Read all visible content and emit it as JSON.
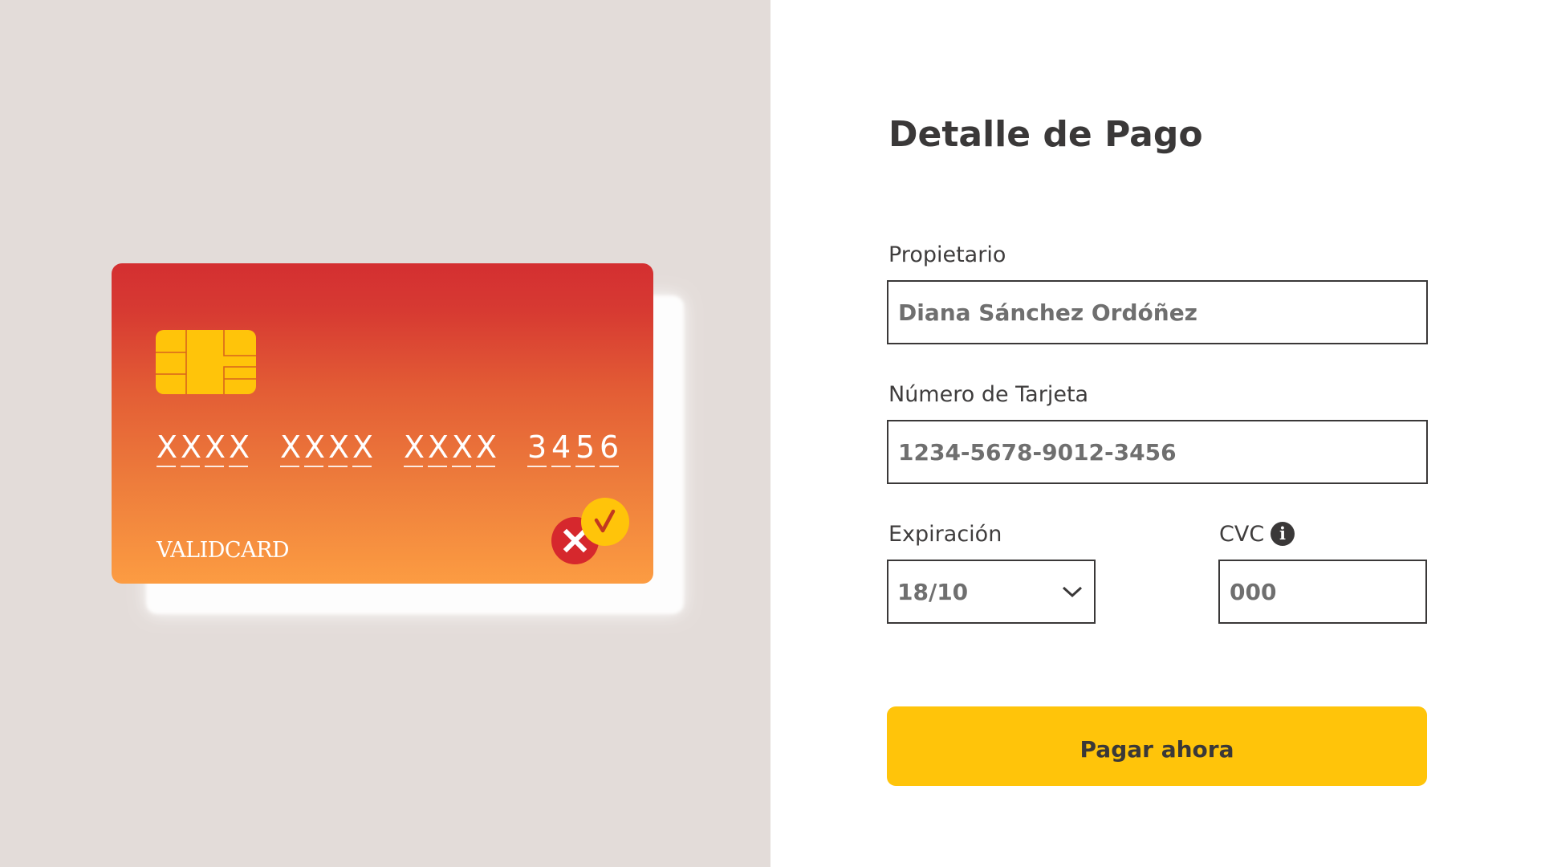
{
  "card": {
    "number_groups": [
      [
        "X",
        "X",
        "X",
        "X"
      ],
      [
        "X",
        "X",
        "X",
        "X"
      ],
      [
        "X",
        "X",
        "X",
        "X"
      ],
      [
        "3",
        "4",
        "5",
        "6"
      ]
    ],
    "brand": "VALIDCARD",
    "status_icons": [
      "close-icon",
      "check-icon"
    ]
  },
  "form": {
    "title": "Detalle de Pago",
    "owner": {
      "label": "Propietario",
      "value": "Diana Sánchez Ordóñez"
    },
    "card_number": {
      "label": "Número de Tarjeta",
      "value": "1234-5678-9012-3456"
    },
    "expiration": {
      "label": "Expiración",
      "value": "18/10"
    },
    "cvc": {
      "label": "CVC",
      "value": "000",
      "icon": "info-icon"
    },
    "submit_label": "Pagar ahora"
  },
  "colors": {
    "left_background": "#e3dcd9",
    "card_gradient_top": "#d42f31",
    "card_gradient_bottom": "#fc9c42",
    "accent_yellow": "#ffc40a",
    "error_red": "#d6282d",
    "text_dark": "#3a3838"
  }
}
